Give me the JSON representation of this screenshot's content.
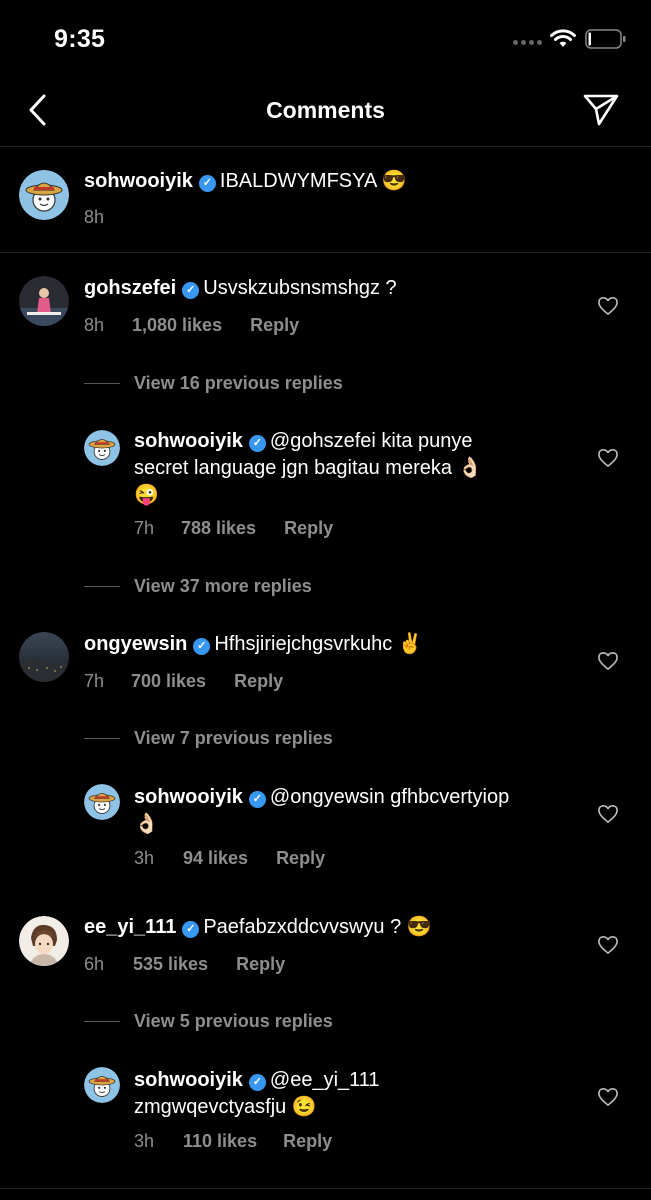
{
  "status": {
    "time": "9:35"
  },
  "header": {
    "title": "Comments"
  },
  "caption": {
    "username": "sohwooiyik",
    "text": "IBALDWYMFSYA 😎",
    "time": "8h"
  },
  "comments": [
    {
      "username": "gohszefei",
      "text": "Usvskzubsnsmshgz ?",
      "time": "8h",
      "likes": "1,080 likes",
      "reply": "Reply",
      "view_more": "View 16 previous replies",
      "reply_item": {
        "username": "sohwooiyik",
        "text_line1": "@gohszefei kita punye",
        "text_line2": "secret language jgn bagitau mereka 👌🏻",
        "text_line3": "😜",
        "time": "7h",
        "likes": "788 likes",
        "reply": "Reply"
      },
      "view_after": "View 37 more replies"
    },
    {
      "username": "ongyewsin",
      "text": "Hfhsjiriejchgsvrkuhc ✌️",
      "time": "7h",
      "likes": "700 likes",
      "reply": "Reply",
      "view_more": "View 7 previous replies",
      "reply_item": {
        "username": "sohwooiyik",
        "text_line1": "@ongyewsin gfhbcvertyiop",
        "text_line2": "👌🏻",
        "time": "3h",
        "likes": "94 likes",
        "reply": "Reply"
      }
    },
    {
      "username": "ee_yi_111",
      "text": "Paefabzxddcvvswyu ? 😎",
      "time": "6h",
      "likes": "535 likes",
      "reply": "Reply",
      "view_more": "View 5 previous replies",
      "reply_item": {
        "username": "sohwooiyik",
        "text_line1": "@ee_yi_111",
        "text_line2": "zmgwqevctyasfju 😉",
        "time": "3h",
        "likes": "110 likes",
        "reply": "Reply"
      }
    }
  ],
  "colors": {
    "background": "#000000",
    "secondary_text": "#8e8e8e",
    "verified_badge": "#3897f0",
    "separator": "#262626"
  }
}
